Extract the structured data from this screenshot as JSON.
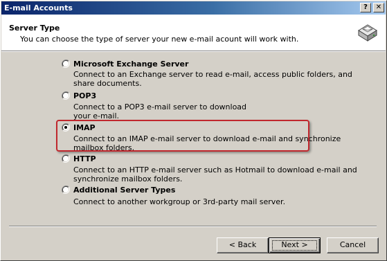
{
  "window": {
    "title": "E-mail Accounts",
    "help_label": "?",
    "close_label": "✕"
  },
  "header": {
    "title": "Server Type",
    "subtitle": "You can choose the type of server your new e-mail acount will work with."
  },
  "options": [
    {
      "title": "Microsoft Exchange Server",
      "description_lines": [
        "Connect to an Exchange server to read e-mail, access public folders, and",
        "share documents."
      ],
      "selected": false
    },
    {
      "title": "POP3",
      "description_lines": [
        "Connect to a POP3 e-mail server to download",
        "your e-mail."
      ],
      "selected": false
    },
    {
      "title": "IMAP",
      "description_lines": [
        "Connect to an IMAP e-mail server to download e-mail and synchronize",
        "mailbox folders."
      ],
      "selected": true
    },
    {
      "title": "HTTP",
      "description_lines": [
        "Connect to an HTTP e-mail server such as Hotmail to download e-mail and",
        "synchronize mailbox folders."
      ],
      "selected": false
    },
    {
      "title": "Additional Server Types",
      "description_lines": [
        "Connect to another workgroup or 3rd-party mail server."
      ],
      "selected": false
    }
  ],
  "buttons": {
    "back": "< Back",
    "next": "Next >",
    "cancel": "Cancel"
  },
  "colors": {
    "titlebar_start": "#0a246a",
    "titlebar_end": "#a6caf0",
    "dialog_face": "#d4d0c8",
    "highlight_outline": "#c0272d"
  },
  "icons": {
    "header": "mail-server-icon",
    "title_help": "help-icon",
    "title_close": "close-icon"
  }
}
